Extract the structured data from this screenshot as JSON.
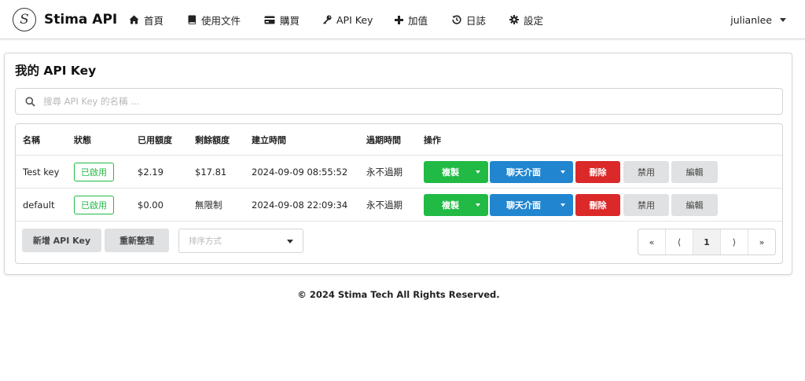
{
  "app": {
    "name": "Stima API",
    "logo_letter": "S"
  },
  "nav": {
    "items": [
      {
        "label": "首頁",
        "icon": "home-icon"
      },
      {
        "label": "使用文件",
        "icon": "book-icon"
      },
      {
        "label": "購買",
        "icon": "card-icon"
      },
      {
        "label": "API Key",
        "icon": "key-icon"
      },
      {
        "label": "加值",
        "icon": "plus-icon"
      },
      {
        "label": "日誌",
        "icon": "history-icon"
      },
      {
        "label": "設定",
        "icon": "gear-icon"
      }
    ],
    "user": "julianlee"
  },
  "page": {
    "title": "我的 API Key",
    "search_placeholder": "搜尋 API Key 的名稱 ..."
  },
  "table": {
    "headers": [
      "名稱",
      "狀態",
      "已用額度",
      "剩餘額度",
      "建立時間",
      "過期時間",
      "操作"
    ],
    "rows": [
      {
        "name": "Test key",
        "status": "已啟用",
        "used": "$2.19",
        "remaining": "$17.81",
        "created": "2024-09-09 08:55:52",
        "expires": "永不過期"
      },
      {
        "name": "default",
        "status": "已啟用",
        "used": "$0.00",
        "remaining": "無限制",
        "created": "2024-09-08 22:09:34",
        "expires": "永不過期"
      }
    ],
    "row_actions": {
      "copy": "複製",
      "chat": "聊天介面",
      "delete": "刪除",
      "disable": "禁用",
      "edit": "編輯"
    }
  },
  "toolbar": {
    "add_label": "新增 API Key",
    "refresh_label": "重新整理",
    "sort_placeholder": "排序方式"
  },
  "pagination": {
    "first": "«",
    "prev": "⟨",
    "current": "1",
    "next": "⟩",
    "last": "»"
  },
  "footer": {
    "copyright": "© 2024 Stima Tech All Rights Reserved."
  },
  "colors": {
    "green": "#21ba45",
    "blue": "#2185d0",
    "red": "#db2828",
    "grey": "#e0e1e2"
  }
}
